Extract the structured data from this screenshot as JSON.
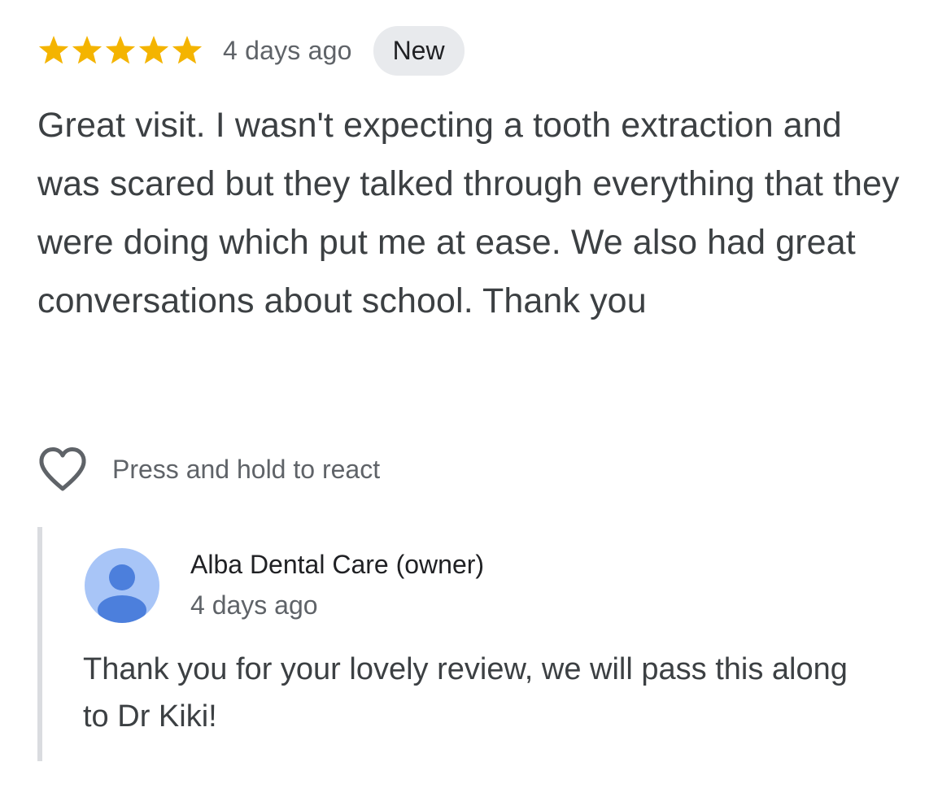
{
  "review": {
    "rating": 5,
    "rating_max": 5,
    "star_color": "#f4b400",
    "date": "4 days ago",
    "badge": "New",
    "text": "Great visit. I wasn't expecting a tooth extraction and was scared but they talked through everything that they were doing which put me at ease. We also had great conversations about school. Thank you"
  },
  "react": {
    "icon": "heart-icon",
    "label": "Press and hold to react"
  },
  "reply": {
    "avatar_icon": "person-avatar-icon",
    "avatar_bg_color": "#a8c5f7",
    "avatar_fg_color": "#4c7fdc",
    "author": "Alba Dental Care (owner)",
    "date": "4 days ago",
    "text": "Thank you for your lovely review, we will pass this along to Dr Kiki!"
  }
}
